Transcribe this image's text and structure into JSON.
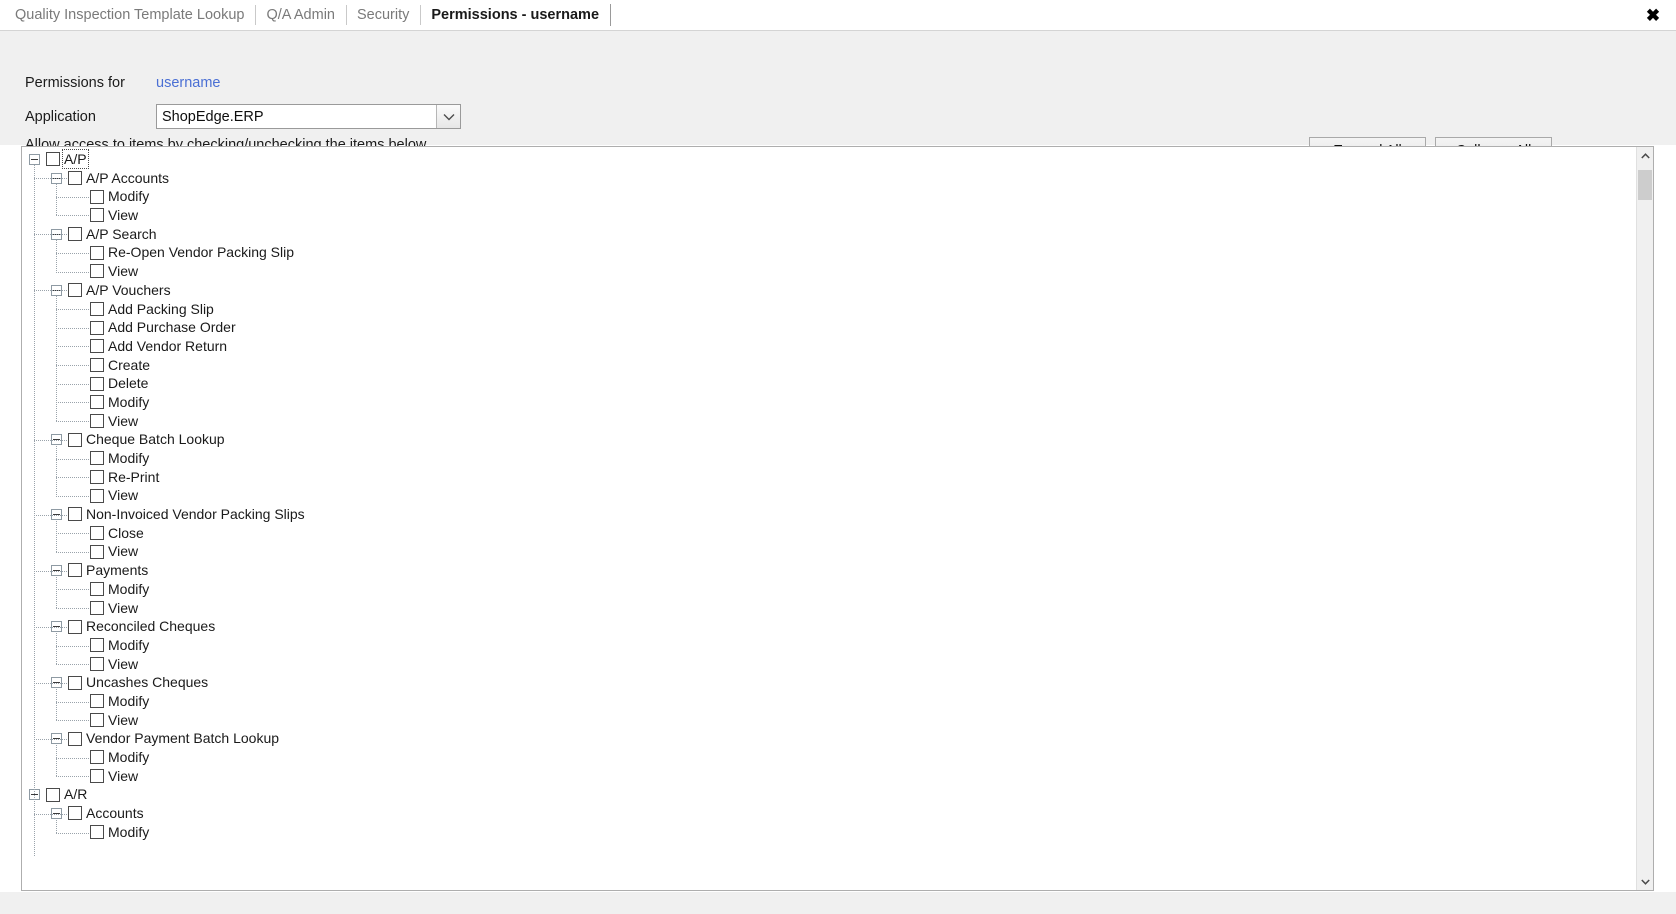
{
  "window": {
    "close_label": "✖"
  },
  "tabs": [
    {
      "label": "Quality Inspection Template Lookup",
      "active": false
    },
    {
      "label": "Q/A Admin",
      "active": false
    },
    {
      "label": "Security",
      "active": false
    },
    {
      "label": "Permissions - username",
      "active": true
    }
  ],
  "form": {
    "permissions_for_label": "Permissions for",
    "username_value": "username",
    "application_label": "Application",
    "application_value": "ShopEdge.ERP",
    "hint": "Allow access to items by checking/unchecking the items below"
  },
  "toolbar": {
    "expand_all_label": "Expand All",
    "collapse_all_label": "Collapse All"
  },
  "colors": {
    "panel_background": "#f0f0f0",
    "link": "#4a6fd4",
    "tree_background": "#ffffff",
    "border": "#aeaeae",
    "scroll_thumb": "#cdcdcd"
  },
  "tree": {
    "focused_node": "A/P",
    "nodes": [
      {
        "label": "A/P",
        "level": 0,
        "expanded": true,
        "checked": false,
        "focused": true
      },
      {
        "label": "A/P Accounts",
        "level": 1,
        "expanded": true,
        "checked": false
      },
      {
        "label": "Modify",
        "level": 2,
        "checked": false
      },
      {
        "label": "View",
        "level": 2,
        "checked": false
      },
      {
        "label": "A/P Search",
        "level": 1,
        "expanded": true,
        "checked": false
      },
      {
        "label": "Re-Open Vendor Packing Slip",
        "level": 2,
        "checked": false
      },
      {
        "label": "View",
        "level": 2,
        "checked": false
      },
      {
        "label": "A/P Vouchers",
        "level": 1,
        "expanded": true,
        "checked": false
      },
      {
        "label": "Add Packing Slip",
        "level": 2,
        "checked": false
      },
      {
        "label": "Add Purchase Order",
        "level": 2,
        "checked": false
      },
      {
        "label": "Add Vendor Return",
        "level": 2,
        "checked": false
      },
      {
        "label": "Create",
        "level": 2,
        "checked": false
      },
      {
        "label": "Delete",
        "level": 2,
        "checked": false
      },
      {
        "label": "Modify",
        "level": 2,
        "checked": false
      },
      {
        "label": "View",
        "level": 2,
        "checked": false
      },
      {
        "label": "Cheque Batch Lookup",
        "level": 1,
        "expanded": true,
        "checked": false
      },
      {
        "label": "Modify",
        "level": 2,
        "checked": false
      },
      {
        "label": "Re-Print",
        "level": 2,
        "checked": false
      },
      {
        "label": "View",
        "level": 2,
        "checked": false
      },
      {
        "label": "Non-Invoiced Vendor Packing Slips",
        "level": 1,
        "expanded": true,
        "checked": false
      },
      {
        "label": "Close",
        "level": 2,
        "checked": false
      },
      {
        "label": "View",
        "level": 2,
        "checked": false
      },
      {
        "label": "Payments",
        "level": 1,
        "expanded": true,
        "checked": false
      },
      {
        "label": "Modify",
        "level": 2,
        "checked": false
      },
      {
        "label": "View",
        "level": 2,
        "checked": false
      },
      {
        "label": "Reconciled Cheques",
        "level": 1,
        "expanded": true,
        "checked": false
      },
      {
        "label": "Modify",
        "level": 2,
        "checked": false
      },
      {
        "label": "View",
        "level": 2,
        "checked": false
      },
      {
        "label": "Uncashes Cheques",
        "level": 1,
        "expanded": true,
        "checked": false
      },
      {
        "label": "Modify",
        "level": 2,
        "checked": false
      },
      {
        "label": "View",
        "level": 2,
        "checked": false
      },
      {
        "label": "Vendor Payment Batch Lookup",
        "level": 1,
        "expanded": true,
        "checked": false
      },
      {
        "label": "Modify",
        "level": 2,
        "checked": false
      },
      {
        "label": "View",
        "level": 2,
        "checked": false
      },
      {
        "label": "A/R",
        "level": 0,
        "expanded": true,
        "checked": false
      },
      {
        "label": "Accounts",
        "level": 1,
        "expanded": true,
        "checked": false
      },
      {
        "label": "Modify",
        "level": 2,
        "checked": false
      }
    ]
  }
}
